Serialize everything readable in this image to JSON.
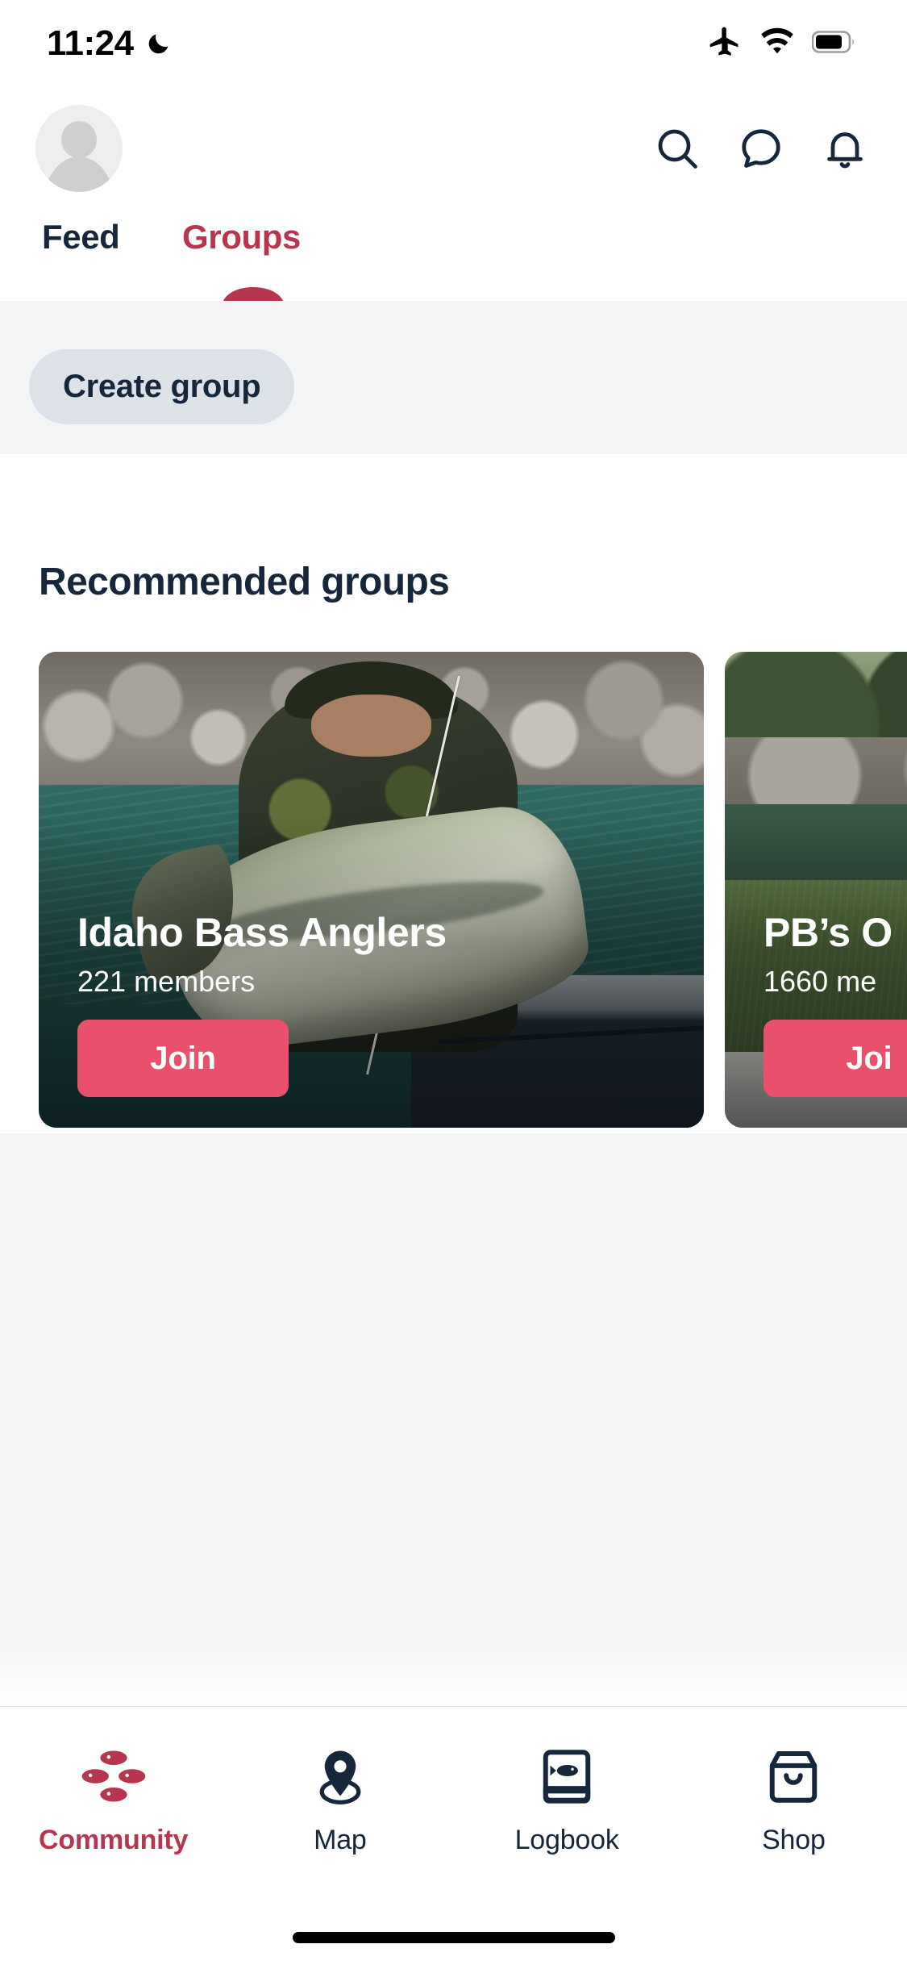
{
  "status_bar": {
    "time": "11:24",
    "moon_icon": "crescent-moon-icon",
    "airplane_icon": "airplane-mode-icon",
    "wifi_icon": "wifi-icon",
    "battery_icon": "battery-icon"
  },
  "header": {
    "avatar": "user-avatar",
    "search_icon": "search-icon",
    "messages_icon": "chat-bubble-icon",
    "notifications_icon": "bell-icon"
  },
  "tabs": {
    "items": [
      {
        "label": "Feed",
        "active": false
      },
      {
        "label": "Groups",
        "active": true
      }
    ],
    "active_color": "#b8354f",
    "inactive_color": "#16273c"
  },
  "toolbar": {
    "create_group_label": "Create group"
  },
  "main": {
    "section_title": "Recommended groups",
    "cards": [
      {
        "title": "Idaho Bass Anglers",
        "members": "221 members",
        "join_label": "Join",
        "photo": "angler-holding-largemouth-bass-on-boat"
      },
      {
        "title": "PB’s O",
        "members": "1660 me",
        "join_label": "Joi",
        "photo": "redfish-held-on-grassy-bank"
      }
    ]
  },
  "bottom_nav": {
    "items": [
      {
        "label": "Community",
        "icon": "four-fish-diamond-icon",
        "active": true
      },
      {
        "label": "Map",
        "icon": "map-pin-icon",
        "active": false
      },
      {
        "label": "Logbook",
        "icon": "book-with-fish-icon",
        "active": false
      },
      {
        "label": "Shop",
        "icon": "shopping-bag-icon",
        "active": false
      }
    ]
  },
  "colors": {
    "accent_crimson": "#b8354f",
    "accent_pink": "#e8506b",
    "navy": "#16273c",
    "surface_gray": "#f3f5f7",
    "pill_gray": "#dde2e8"
  },
  "system": {
    "home_indicator": "home-indicator-bar"
  }
}
